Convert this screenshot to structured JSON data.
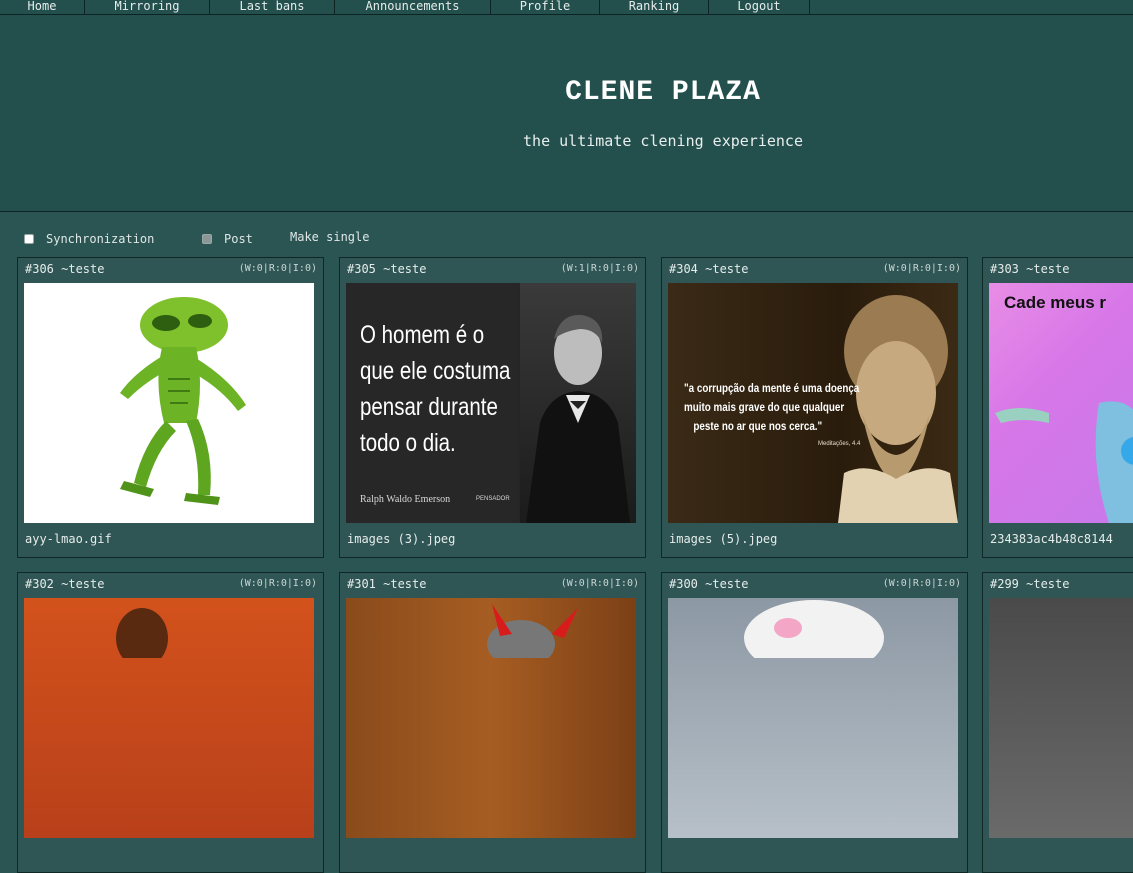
{
  "nav": {
    "items": [
      {
        "label": "Home"
      },
      {
        "label": "Mirroring"
      },
      {
        "label": "Last bans"
      },
      {
        "label": "Announcements"
      },
      {
        "label": "Profile"
      },
      {
        "label": "Ranking"
      },
      {
        "label": "Logout"
      }
    ]
  },
  "header": {
    "title": "CLENE PLAZA",
    "subtitle": "the ultimate clening experience"
  },
  "controls": {
    "sync_label": "Synchronization",
    "post_label": "Post",
    "make_single_label": "Make single"
  },
  "threads": [
    {
      "id": "#306 ~teste",
      "meta": "(W:0|R:0|I:0)",
      "filename": "ayy-lmao.gif"
    },
    {
      "id": "#305 ~teste",
      "meta": "(W:1|R:0|I:0)",
      "filename": "images (3).jpeg",
      "image_text": {
        "quote": [
          "O homem é o",
          "que ele costuma",
          "pensar durante",
          "todo o dia."
        ],
        "author": "Ralph Waldo Emerson",
        "brand": "PENSADOR"
      }
    },
    {
      "id": "#304 ~teste",
      "meta": "(W:0|R:0|I:0)",
      "filename": "images (5).jpeg",
      "image_text": {
        "quote": [
          "\"a corrupção da mente é uma doença",
          "muito mais grave do que qualquer",
          "peste no ar que nos cerca.\""
        ],
        "source": "Meditações, 4.4"
      }
    },
    {
      "id": "#303 ~teste",
      "meta": "",
      "filename": "234383ac4b48c8144",
      "image_text": {
        "caption": "Cade meus r"
      }
    },
    {
      "id": "#302 ~teste",
      "meta": "(W:0|R:0|I:0)",
      "filename": ""
    },
    {
      "id": "#301 ~teste",
      "meta": "(W:0|R:0|I:0)",
      "filename": ""
    },
    {
      "id": "#300 ~teste",
      "meta": "(W:0|R:0|I:0)",
      "filename": ""
    },
    {
      "id": "#299 ~teste",
      "meta": "",
      "filename": ""
    }
  ]
}
